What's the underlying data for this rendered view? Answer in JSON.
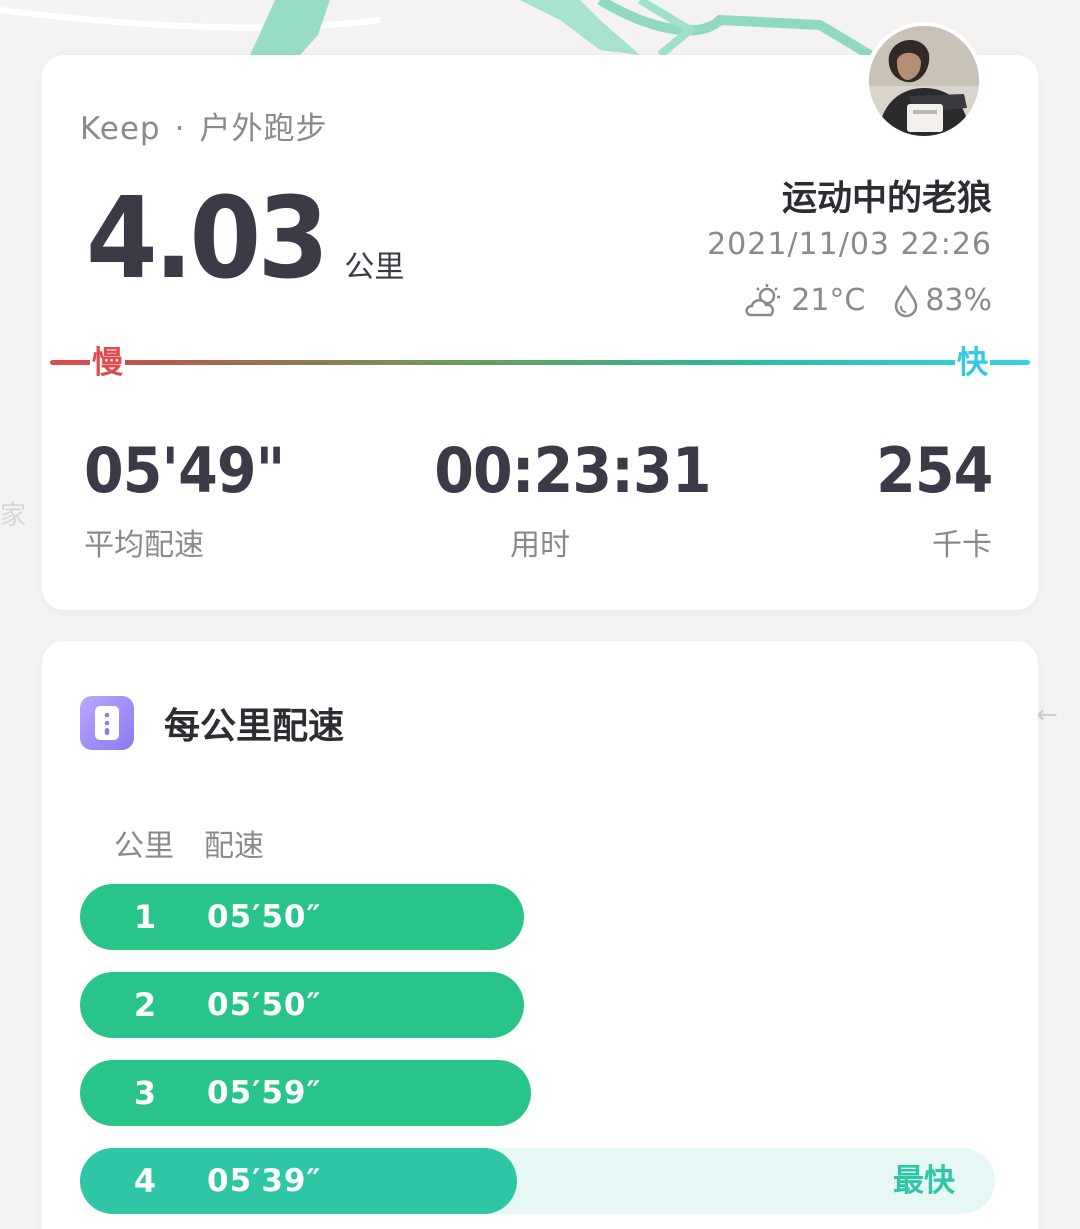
{
  "summary": {
    "app_name": "Keep",
    "separator": "·",
    "activity_type": "户外跑步",
    "distance_value": "4.03",
    "distance_unit": "公里",
    "username": "运动中的老狼",
    "datetime": "2021/11/03 22:26",
    "temperature": "21°C",
    "humidity": "83%",
    "weather_icon": "partly-cloudy-icon",
    "humidity_icon": "water-drop-icon",
    "speed_scale": {
      "slow_label": "慢",
      "fast_label": "快"
    },
    "stats": {
      "avg_pace_value": "05'49\"",
      "avg_pace_label": "平均配速",
      "duration_value": "00:23:31",
      "duration_label": "用时",
      "calories_value": "254",
      "calories_label": "千卡"
    }
  },
  "pace_section": {
    "title": "每公里配速",
    "icon": "ruler-icon",
    "col_km": "公里",
    "col_pace": "配速",
    "rows": [
      {
        "km": "1",
        "pace": "05′50″",
        "fill": 0.485,
        "badge": ""
      },
      {
        "km": "2",
        "pace": "05′50″",
        "fill": 0.485,
        "badge": ""
      },
      {
        "km": "3",
        "pace": "05′59″",
        "fill": 0.493,
        "badge": ""
      },
      {
        "km": "4",
        "pace": "05′39″",
        "fill": 0.478,
        "badge": "最快"
      }
    ]
  },
  "background": {
    "side_text": "家",
    "right_glyph": "←"
  },
  "colors": {
    "pace_bar": "#28c48a",
    "fastest_bar": "#2fc6a6",
    "slow": "#e04c4c",
    "fast": "#33c9e3",
    "text_dark": "#3c3a47"
  }
}
